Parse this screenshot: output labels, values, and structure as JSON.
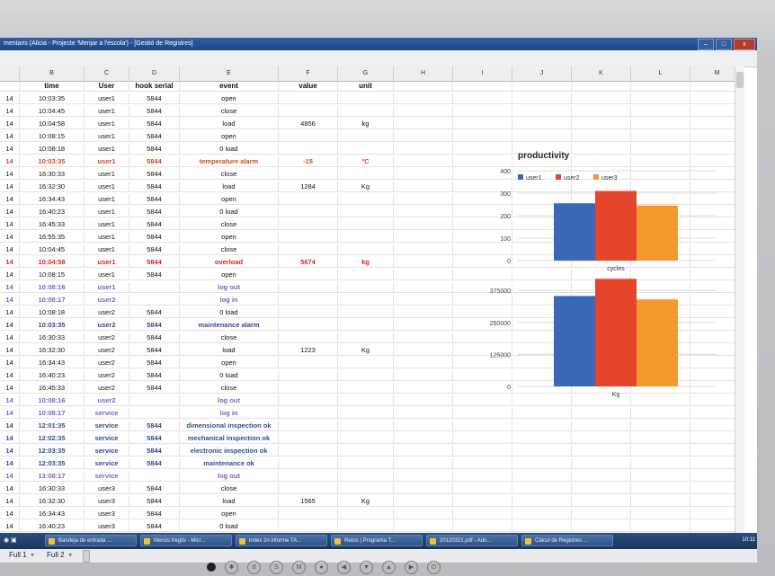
{
  "window": {
    "title": "mentaris (Alicia - Projecte 'Menjar a l'escola') - [Gestió de Registres]",
    "buttons": [
      "–",
      "□",
      "x"
    ]
  },
  "columns": [
    "B",
    "C",
    "D",
    "E",
    "F",
    "G",
    "H",
    "I",
    "J",
    "K",
    "L",
    "M"
  ],
  "header": {
    "a": "",
    "time": "time",
    "user": "User",
    "hook": "hook serial",
    "event": "event",
    "value": "value",
    "unit": "unit"
  },
  "rows": [
    {
      "a": "14",
      "time": "10:03:35",
      "user": "user1",
      "hook": "5844",
      "event": "open",
      "value": "",
      "unit": "",
      "style": "normal"
    },
    {
      "a": "14",
      "time": "10:04:45",
      "user": "user1",
      "hook": "5844",
      "event": "close",
      "value": "",
      "unit": "",
      "style": "normal"
    },
    {
      "a": "14",
      "time": "10:04:58",
      "user": "user1",
      "hook": "5844",
      "event": "load",
      "value": "4856",
      "unit": "kg",
      "style": "normal"
    },
    {
      "a": "14",
      "time": "10:08:15",
      "user": "user1",
      "hook": "5844",
      "event": "open",
      "value": "",
      "unit": "",
      "style": "normal"
    },
    {
      "a": "14",
      "time": "10:08:18",
      "user": "user1",
      "hook": "5844",
      "event": "0 load",
      "value": "",
      "unit": "",
      "style": "normal"
    },
    {
      "a": "14",
      "time": "10:03:35",
      "user": "user1",
      "hook": "5844",
      "event": "temperature alarm",
      "value": "-15",
      "unit": "ºC",
      "style": "temp"
    },
    {
      "a": "14",
      "time": "16:30:33",
      "user": "user1",
      "hook": "5844",
      "event": "close",
      "value": "",
      "unit": "",
      "style": "normal"
    },
    {
      "a": "14",
      "time": "16:32:30",
      "user": "user1",
      "hook": "5844",
      "event": "load",
      "value": "1284",
      "unit": "Kg",
      "style": "normal"
    },
    {
      "a": "14",
      "time": "16:34:43",
      "user": "user1",
      "hook": "5844",
      "event": "open",
      "value": "",
      "unit": "",
      "style": "normal"
    },
    {
      "a": "14",
      "time": "16:40:23",
      "user": "user1",
      "hook": "5844",
      "event": "0 load",
      "value": "",
      "unit": "",
      "style": "normal"
    },
    {
      "a": "14",
      "time": "16:45:33",
      "user": "user1",
      "hook": "5844",
      "event": "close",
      "value": "",
      "unit": "",
      "style": "normal"
    },
    {
      "a": "14",
      "time": "16:55:35",
      "user": "user1",
      "hook": "5844",
      "event": "open",
      "value": "",
      "unit": "",
      "style": "normal"
    },
    {
      "a": "14",
      "time": "10:04:45",
      "user": "user1",
      "hook": "5844",
      "event": "close",
      "value": "",
      "unit": "",
      "style": "normal"
    },
    {
      "a": "14",
      "time": "10:04:58",
      "user": "user1",
      "hook": "5844",
      "event": "overload",
      "value": "5674",
      "unit": "kg",
      "style": "overload"
    },
    {
      "a": "14",
      "time": "10:08:15",
      "user": "user1",
      "hook": "5844",
      "event": "open",
      "value": "",
      "unit": "",
      "style": "normal"
    },
    {
      "a": "14",
      "time": "10:08:16",
      "user": "user1",
      "hook": "",
      "event": "log out",
      "value": "",
      "unit": "",
      "style": "log"
    },
    {
      "a": "14",
      "time": "10:08:17",
      "user": "user2",
      "hook": "",
      "event": "log in",
      "value": "",
      "unit": "",
      "style": "log"
    },
    {
      "a": "14",
      "time": "10:08:18",
      "user": "user2",
      "hook": "5844",
      "event": "0 load",
      "value": "",
      "unit": "",
      "style": "normal"
    },
    {
      "a": "14",
      "time": "10:03:35",
      "user": "user2",
      "hook": "5844",
      "event": "maintenance alarm",
      "value": "",
      "unit": "",
      "style": "maint"
    },
    {
      "a": "14",
      "time": "16:30:33",
      "user": "user2",
      "hook": "5844",
      "event": "close",
      "value": "",
      "unit": "",
      "style": "normal"
    },
    {
      "a": "14",
      "time": "16:32:30",
      "user": "user2",
      "hook": "5844",
      "event": "load",
      "value": "1223",
      "unit": "Kg",
      "style": "normal"
    },
    {
      "a": "14",
      "time": "16:34:43",
      "user": "user2",
      "hook": "5844",
      "event": "open",
      "value": "",
      "unit": "",
      "style": "normal"
    },
    {
      "a": "14",
      "time": "16:40:23",
      "user": "user2",
      "hook": "5844",
      "event": "0 load",
      "value": "",
      "unit": "",
      "style": "normal"
    },
    {
      "a": "14",
      "time": "16:45:33",
      "user": "user2",
      "hook": "5844",
      "event": "close",
      "value": "",
      "unit": "",
      "style": "normal"
    },
    {
      "a": "14",
      "time": "10:08:16",
      "user": "user2",
      "hook": "",
      "event": "log out",
      "value": "",
      "unit": "",
      "style": "log"
    },
    {
      "a": "14",
      "time": "10:08:17",
      "user": "service",
      "hook": "",
      "event": "log in",
      "value": "",
      "unit": "",
      "style": "log"
    },
    {
      "a": "14",
      "time": "12:01:35",
      "user": "service",
      "hook": "5844",
      "event": "dimensional inspection ok",
      "value": "",
      "unit": "",
      "style": "maint"
    },
    {
      "a": "14",
      "time": "12:02:35",
      "user": "service",
      "hook": "5844",
      "event": "mechanical inspection ok",
      "value": "",
      "unit": "",
      "style": "maint"
    },
    {
      "a": "14",
      "time": "12:03:35",
      "user": "service",
      "hook": "5844",
      "event": "electronic inspection ok",
      "value": "",
      "unit": "",
      "style": "maint"
    },
    {
      "a": "14",
      "time": "12:03:35",
      "user": "service",
      "hook": "5844",
      "event": "maintenance ok",
      "value": "",
      "unit": "",
      "style": "maint"
    },
    {
      "a": "14",
      "time": "13:08:17",
      "user": "service",
      "hook": "",
      "event": "log out",
      "value": "",
      "unit": "",
      "style": "log"
    },
    {
      "a": "14",
      "time": "16:30:33",
      "user": "user3",
      "hook": "5844",
      "event": "close",
      "value": "",
      "unit": "",
      "style": "normal"
    },
    {
      "a": "14",
      "time": "16:32:30",
      "user": "user3",
      "hook": "5844",
      "event": "load",
      "value": "1565",
      "unit": "Kg",
      "style": "normal"
    },
    {
      "a": "14",
      "time": "16:34:43",
      "user": "user3",
      "hook": "5844",
      "event": "open",
      "value": "",
      "unit": "",
      "style": "normal"
    },
    {
      "a": "14",
      "time": "16:40:23",
      "user": "user3",
      "hook": "5844",
      "event": "0 load",
      "value": "",
      "unit": "",
      "style": "normal"
    }
  ],
  "styles": {
    "normal": "#111111",
    "temp": "#c9501c",
    "overload": "#d42626",
    "log": "#7366c4",
    "maint": "#2d4f8e"
  },
  "sheets": [
    {
      "label": "Full 1"
    },
    {
      "label": "Full 2"
    }
  ],
  "taskbar": {
    "tasks": [
      "Bandeja de entrada ...",
      "Menús fregits - Micr...",
      "index 2n informe TA...",
      "Retos | Programa T...",
      "20120321.pdf - Ado...",
      "Càlcul de Registres ..."
    ],
    "clock": "10:11"
  },
  "chart_data": [
    {
      "type": "bar",
      "title": "productivity",
      "categories": [
        "cycles"
      ],
      "series": [
        {
          "name": "user1",
          "values": [
            255
          ],
          "color": "#3a68b8"
        },
        {
          "name": "user2",
          "values": [
            310
          ],
          "color": "#e5452a"
        },
        {
          "name": "user3",
          "values": [
            245
          ],
          "color": "#f39a2f"
        }
      ],
      "xlabel": "cycles",
      "ylim": [
        0,
        400
      ],
      "yticks": [
        0,
        100,
        200,
        300,
        400
      ],
      "legend": "top-left"
    },
    {
      "type": "bar",
      "title": "",
      "categories": [
        "Kg"
      ],
      "series": [
        {
          "name": "user1",
          "values": [
            353000
          ],
          "color": "#3a68b8"
        },
        {
          "name": "user2",
          "values": [
            420000
          ],
          "color": "#e5452a"
        },
        {
          "name": "user3",
          "values": [
            340000
          ],
          "color": "#f39a2f"
        }
      ],
      "xlabel": "Kg",
      "ylim": [
        0,
        400000
      ],
      "yticks": [
        0,
        125000,
        250000,
        375000
      ],
      "legend": "none"
    }
  ]
}
